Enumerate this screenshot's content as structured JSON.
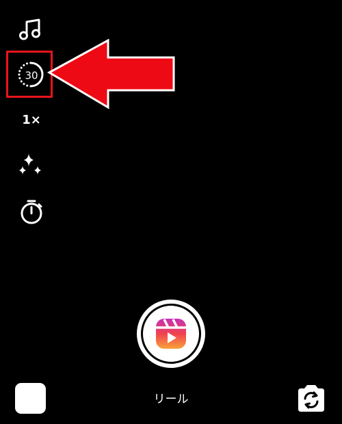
{
  "side_tools": {
    "music_icon": "music-note-icon",
    "length_value": "30",
    "speed_label": "1×",
    "effects_icon": "sparkles-icon",
    "timer_icon": "timer-icon"
  },
  "annotation": {
    "highlight_color": "#e8141c",
    "arrow_color": "#ee0a14"
  },
  "capture": {
    "icon": "reels-icon",
    "mode_label": "リール"
  },
  "bottom_bar": {
    "gallery_icon": "gallery-thumbnail",
    "flip_icon": "flip-camera-icon"
  }
}
